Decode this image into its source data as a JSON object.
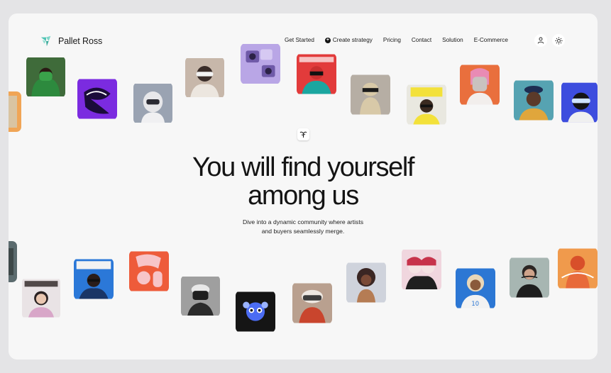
{
  "brand": {
    "name": "Pallet Ross",
    "logo_icon": "leaf-logo-icon",
    "accent": "#4fc3b4"
  },
  "nav": {
    "items": [
      {
        "label": "Get Started"
      },
      {
        "label": "Create strategy",
        "icon": "plus-circle-icon"
      },
      {
        "label": "Pricing"
      },
      {
        "label": "Contact"
      },
      {
        "label": "Solution"
      },
      {
        "label": "E-Commerce"
      }
    ],
    "user_icon": "user-icon",
    "theme_icon": "sun-icon"
  },
  "hero": {
    "headline_line1": "You will find yourself",
    "headline_line2": "among us",
    "sub_line1": "Dive into a dynamic community where artists",
    "sub_line2": "and buyers seamlessly merge."
  },
  "tiles": {
    "top": [
      {
        "name": "artwork-green-puffer",
        "bg": "#3f6b3a",
        "fg": "#2d8a3e"
      },
      {
        "name": "artwork-purple-graffiti",
        "bg": "#7b2be0",
        "fg": "#1b0c3a"
      },
      {
        "name": "artwork-astronaut-helmet",
        "bg": "#9aa3b2",
        "fg": "#e7e7ea"
      },
      {
        "name": "artwork-goggles-fur",
        "bg": "#c7b7aa",
        "fg": "#3a2d29"
      },
      {
        "name": "artwork-purple-cameras",
        "bg": "#b9a6e6",
        "fg": "#6f5aa8"
      },
      {
        "name": "artwork-red-magazine",
        "bg": "#e23b3b",
        "fg": "#1ba6a0"
      },
      {
        "name": "artwork-beige-cyborg",
        "bg": "#b6aea4",
        "fg": "#d8c9a8"
      },
      {
        "name": "artwork-yellow-xaxa",
        "bg": "#e9e8e0",
        "fg": "#f3e13a"
      },
      {
        "name": "artwork-robot-girl",
        "bg": "#e96f3d",
        "fg": "#c9c2bf"
      },
      {
        "name": "artwork-man-hat",
        "bg": "#56a3b2",
        "fg": "#1d2d52"
      },
      {
        "name": "artwork-blue-glasses",
        "bg": "#3d4dde",
        "fg": "#151515"
      }
    ],
    "bottom": [
      {
        "name": "artwork-fashion-cover",
        "bg": "#e9e3e5",
        "fg": "#2a2222"
      },
      {
        "name": "artwork-sunny-magazine",
        "bg": "#2b78d8",
        "fg": "#f2f2f2"
      },
      {
        "name": "artwork-pink-3d-letters",
        "bg": "#ee5b3a",
        "fg": "#f7c4c8"
      },
      {
        "name": "artwork-white-cap",
        "bg": "#9f9f9f",
        "fg": "#e8e8e8"
      },
      {
        "name": "artwork-blue-monster",
        "bg": "#151515",
        "fg": "#4b6cf2"
      },
      {
        "name": "artwork-winter-goggles",
        "bg": "#b9a08f",
        "fg": "#3d3d3d"
      },
      {
        "name": "artwork-curly-woman",
        "bg": "#cfd3dc",
        "fg": "#3a2623"
      },
      {
        "name": "artwork-anime-twins",
        "bg": "#f0d6de",
        "fg": "#c7334b"
      },
      {
        "name": "artwork-football-kid",
        "bg": "#2c77d4",
        "fg": "#e9d7b8"
      },
      {
        "name": "artwork-dali-portrait",
        "bg": "#a7b6b2",
        "fg": "#2c2624"
      },
      {
        "name": "artwork-orange-figure",
        "bg": "#f09a4c",
        "fg": "#d84f2a"
      }
    ]
  }
}
